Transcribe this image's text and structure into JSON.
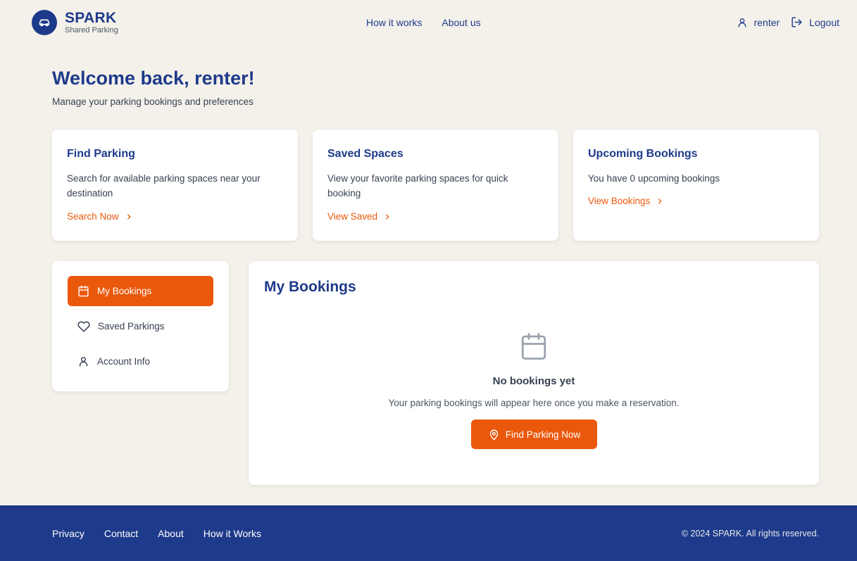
{
  "brand": {
    "name": "SPARK",
    "tagline": "Shared Parking"
  },
  "nav": {
    "how_it_works": "How it works",
    "about_us": "About us"
  },
  "user": {
    "name": "renter",
    "logout": "Logout"
  },
  "welcome": {
    "title": "Welcome back, renter!",
    "subtitle": "Manage your parking bookings and preferences"
  },
  "cards": [
    {
      "title": "Find Parking",
      "description": "Search for available parking spaces near your destination",
      "link": "Search Now"
    },
    {
      "title": "Saved Spaces",
      "description": "View your favorite parking spaces for quick booking",
      "link": "View Saved"
    },
    {
      "title": "Upcoming Bookings",
      "description": "You have 0 upcoming bookings",
      "link": "View Bookings"
    }
  ],
  "sidebar": {
    "items": [
      {
        "label": "My Bookings",
        "icon": "calendar-icon",
        "active": true
      },
      {
        "label": "Saved Parkings",
        "icon": "heart-icon",
        "active": false
      },
      {
        "label": "Account Info",
        "icon": "user-icon",
        "active": false
      }
    ]
  },
  "bookings": {
    "title": "My Bookings",
    "empty_title": "No bookings yet",
    "empty_description": "Your parking bookings will appear here once you make a reservation.",
    "cta": "Find Parking Now"
  },
  "footer": {
    "links": [
      "Privacy",
      "Contact",
      "About",
      "How it Works"
    ],
    "copyright": "© 2024 SPARK. All rights reserved."
  },
  "colors": {
    "primary": "#1e3a8a",
    "accent": "#ea580c",
    "background": "#f4f1eb"
  }
}
